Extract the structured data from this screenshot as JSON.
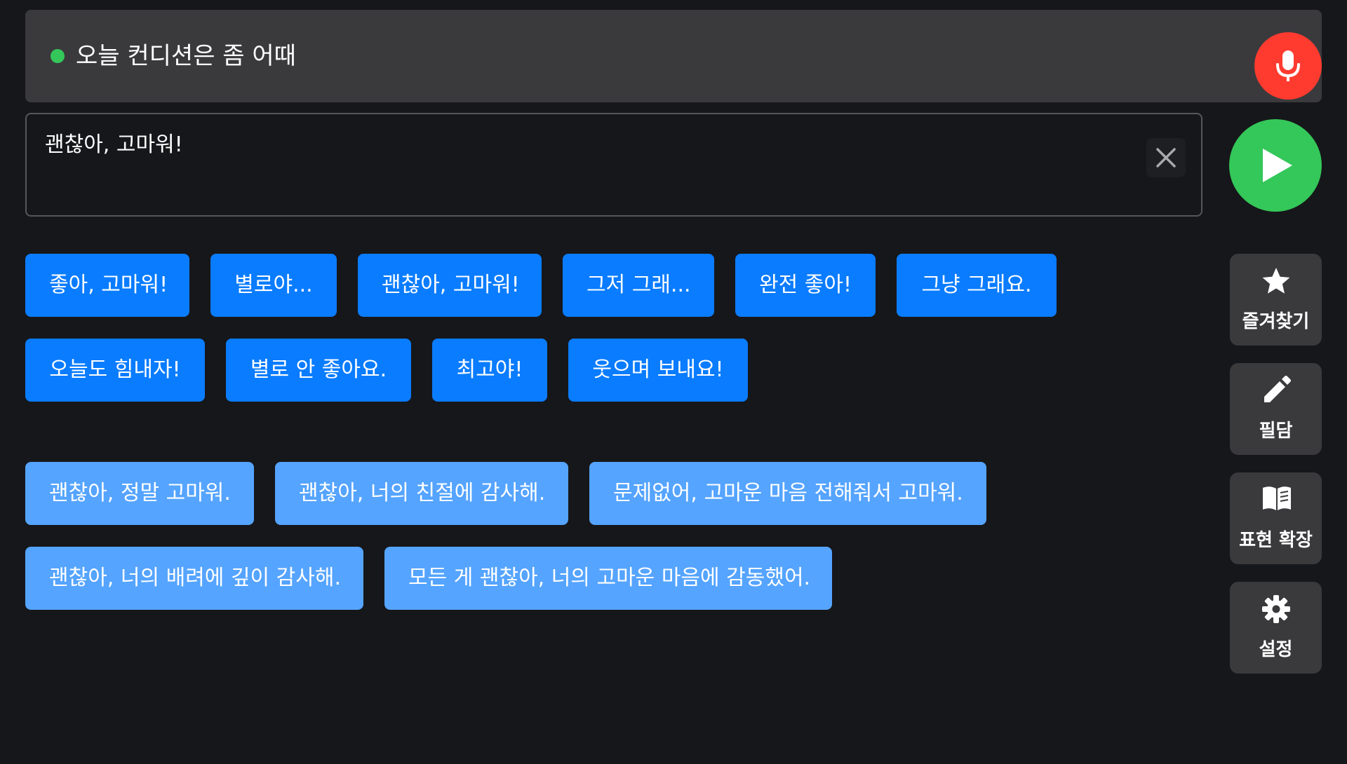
{
  "heard": {
    "text": "오늘 컨디션은 좀 어때",
    "status_color": "#34c759"
  },
  "input": {
    "value": "괜찮아, 고마워!"
  },
  "icons": {
    "mic": "microphone-icon",
    "clear": "close-icon",
    "play": "play-icon",
    "favorites": "star-icon",
    "writing": "pencil-icon",
    "expand": "book-icon",
    "settings": "gear-icon"
  },
  "responses": [
    "좋아, 고마워!",
    "별로야...",
    "괜찮아, 고마워!",
    "그저 그래...",
    "완전 좋아!",
    "그냥 그래요.",
    "오늘도 힘내자!",
    "별로 안 좋아요.",
    "최고야!",
    "웃으며 보내요!"
  ],
  "expansions": [
    "괜찮아, 정말 고마워.",
    "괜찮아, 너의 친절에 감사해.",
    "문제없어, 고마운 마음 전해줘서 고마워.",
    "괜찮아, 너의 배려에 깊이 감사해.",
    "모든 게 괜찮아, 너의 고마운 마음에 감동했어."
  ],
  "side": {
    "favorites": "즐겨찾기",
    "writing": "필담",
    "expand": "표현 확장",
    "settings": "설정"
  },
  "colors": {
    "background": "#16171a",
    "bar": "#3a3a3d",
    "mic": "#ff3b30",
    "play": "#34c759",
    "chip_primary": "#0a7cff",
    "chip_secondary": "#55a4ff"
  }
}
